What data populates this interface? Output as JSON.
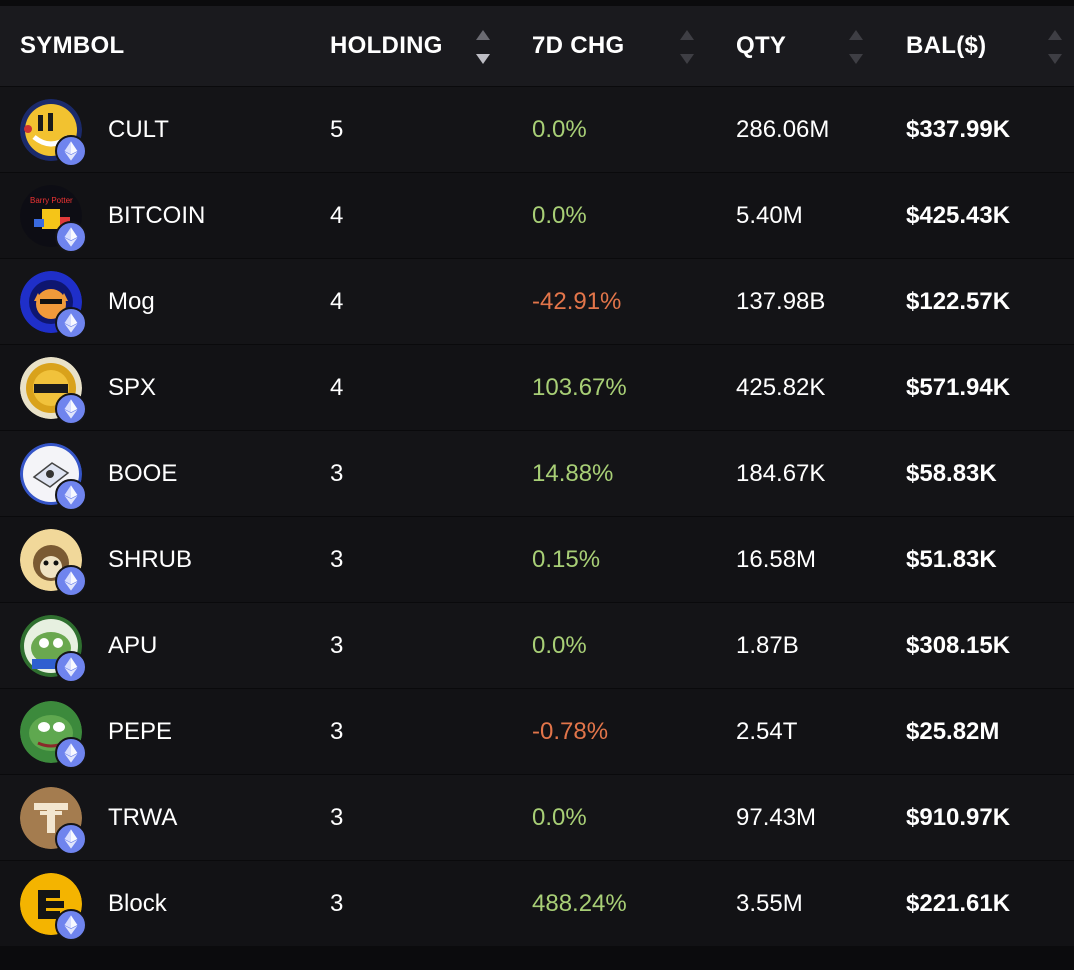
{
  "header": {
    "symbol": "SYMBOL",
    "holding": "HOLDING",
    "chg": "7D CHG",
    "qty": "QTY",
    "bal": "BAL($)"
  },
  "colors": {
    "positive": "#a8cf76",
    "negative": "#e2754a",
    "eth_badge": "#6f84ee"
  },
  "rows": [
    {
      "symbol": "CULT",
      "holding": "5",
      "chg": "0.0%",
      "chg_dir": "pos",
      "qty": "286.06M",
      "bal": "$337.99K",
      "icon": "cult-token-icon"
    },
    {
      "symbol": "BITCOIN",
      "holding": "4",
      "chg": "0.0%",
      "chg_dir": "pos",
      "qty": "5.40M",
      "bal": "$425.43K",
      "icon": "bitcoin-token-icon"
    },
    {
      "symbol": "Mog",
      "holding": "4",
      "chg": "-42.91%",
      "chg_dir": "neg",
      "qty": "137.98B",
      "bal": "$122.57K",
      "icon": "mog-token-icon"
    },
    {
      "symbol": "SPX",
      "holding": "4",
      "chg": "103.67%",
      "chg_dir": "pos",
      "qty": "425.82K",
      "bal": "$571.94K",
      "icon": "spx-token-icon"
    },
    {
      "symbol": "BOOE",
      "holding": "3",
      "chg": "14.88%",
      "chg_dir": "pos",
      "qty": "184.67K",
      "bal": "$58.83K",
      "icon": "booe-token-icon"
    },
    {
      "symbol": "SHRUB",
      "holding": "3",
      "chg": "0.15%",
      "chg_dir": "pos",
      "qty": "16.58M",
      "bal": "$51.83K",
      "icon": "shrub-token-icon"
    },
    {
      "symbol": "APU",
      "holding": "3",
      "chg": "0.0%",
      "chg_dir": "pos",
      "qty": "1.87B",
      "bal": "$308.15K",
      "icon": "apu-token-icon"
    },
    {
      "symbol": "PEPE",
      "holding": "3",
      "chg": "-0.78%",
      "chg_dir": "neg",
      "qty": "2.54T",
      "bal": "$25.82M",
      "icon": "pepe-token-icon"
    },
    {
      "symbol": "TRWA",
      "holding": "3",
      "chg": "0.0%",
      "chg_dir": "pos",
      "qty": "97.43M",
      "bal": "$910.97K",
      "icon": "trwa-token-icon"
    },
    {
      "symbol": "Block",
      "holding": "3",
      "chg": "488.24%",
      "chg_dir": "pos",
      "qty": "3.55M",
      "bal": "$221.61K",
      "icon": "block-token-icon"
    }
  ]
}
